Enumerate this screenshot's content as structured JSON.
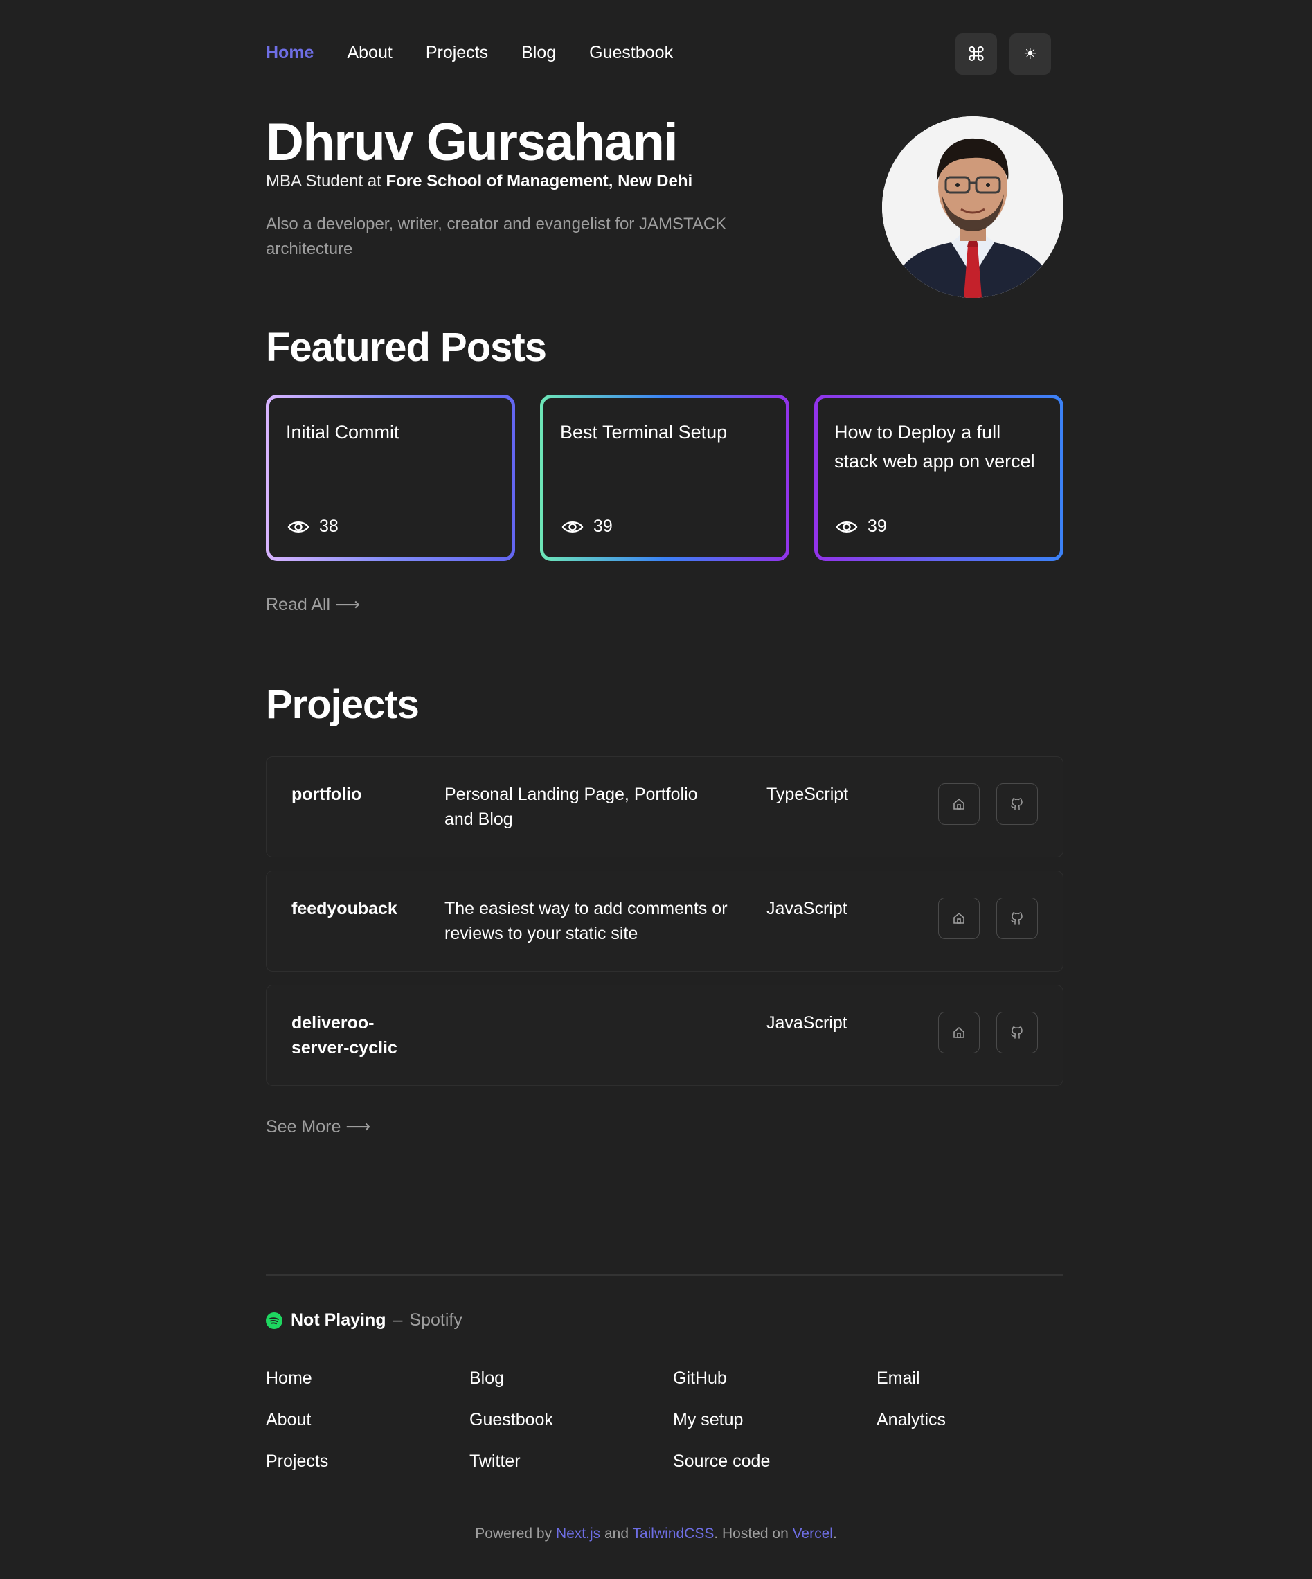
{
  "nav": {
    "links": [
      "Home",
      "About",
      "Projects",
      "Blog",
      "Guestbook"
    ],
    "active": "Home",
    "icons": [
      "command-icon",
      "sun-icon"
    ]
  },
  "hero": {
    "name": "Dhruv Gursahani",
    "role_prefix": "MBA Student at ",
    "role_org": "Fore School of Management, New Dehi",
    "description": "Also a developer, writer, creator and evangelist for JAMSTACK architecture"
  },
  "featured": {
    "title": "Featured Posts",
    "posts": [
      {
        "title": "Initial Commit",
        "views": "38",
        "gradient": [
          "#d8b4fe",
          "#818cf8",
          "#6366f1"
        ]
      },
      {
        "title": "Best Terminal Setup",
        "views": "39",
        "gradient": [
          "#6ee7b7",
          "#3b82f6",
          "#9333ea"
        ]
      },
      {
        "title": "How to Deploy a full stack web app on vercel",
        "views": "39",
        "gradient": [
          "#9333ea",
          "#6366f1",
          "#3b82f6"
        ]
      }
    ],
    "read_all": "Read All"
  },
  "projects": {
    "title": "Projects",
    "items": [
      {
        "name": "portfolio",
        "description": "Personal Landing Page, Portfolio and Blog",
        "language": "TypeScript"
      },
      {
        "name": "feedyouback",
        "description": "The easiest way to add comments or reviews to your static site",
        "language": "JavaScript"
      },
      {
        "name": "deliveroo-server-cyclic",
        "description": "",
        "language": "JavaScript"
      }
    ],
    "see_more": "See More"
  },
  "footer": {
    "spotify_status": "Not Playing",
    "spotify_label": "Spotify",
    "columns": [
      [
        "Home",
        "About",
        "Projects"
      ],
      [
        "Blog",
        "Guestbook",
        "Twitter"
      ],
      [
        "GitHub",
        "My setup",
        "Source code"
      ],
      [
        "Email",
        "Analytics"
      ]
    ],
    "credits": {
      "prefix": "Powered by ",
      "nextjs": "Next.js",
      "and": " and ",
      "tailwind": "TailwindCSS",
      "hosted": ". Hosted on ",
      "vercel": "Vercel",
      "suffix": "."
    }
  },
  "colors": {
    "background": "#212121",
    "accent": "#6e6ee4",
    "muted": "#9e9e9e",
    "spotify": "#1ed760"
  }
}
